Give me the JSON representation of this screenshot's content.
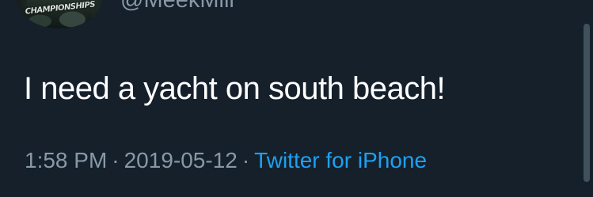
{
  "tweet": {
    "handle": "@MeekMill",
    "avatar_text": "CHAMPIONSHIPS",
    "text": "I need a yacht on south beach!",
    "time": "1:58 PM",
    "date": "2019-05-12",
    "separator": "·",
    "source": "Twitter for iPhone"
  },
  "colors": {
    "background": "#15202b",
    "text": "#ffffff",
    "muted": "#8899a6",
    "link": "#1da1f2"
  }
}
